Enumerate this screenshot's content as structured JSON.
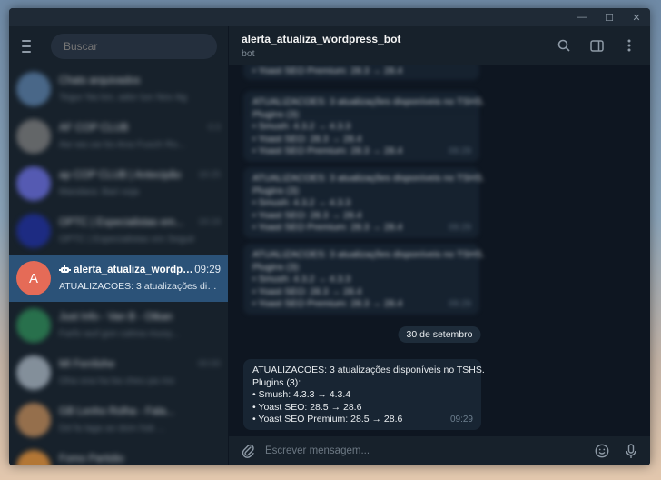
{
  "window": {
    "minimize_glyph": "—",
    "maximize_glyph": "☐",
    "close_glyph": "✕"
  },
  "sidebar": {
    "search_placeholder": "Buscar",
    "chats_above": [
      {
        "name": "Chats arquivados",
        "preview": "Tegur Na lon, ador tun Nov Ag",
        "time": "",
        "color": "#5a7fa8"
      },
      {
        "name": "AF COP CLUB",
        "preview": "Aw wa uw bo Ana Fusch Ro...",
        "time": "0:3",
        "color": "#7d7d7d"
      },
      {
        "name": "ap COP CLUB | Antecipão",
        "preview": "Mandara: Bari soja",
        "time": "18:25",
        "color": "#6a6ee0"
      },
      {
        "name": "OPTC | Especialistas em...",
        "preview": "OPTC | Especialistas em Seguir",
        "time": "19:19",
        "color": "#1f2fa0"
      }
    ],
    "active_chat": {
      "avatar_letter": "A",
      "name": "alerta_atualiza_wordpress_bot",
      "time": "09:29",
      "preview": "ATUALIZACOES: 3 atualizações disponíveis no TSHS.",
      "avatar_color": "#e56b57"
    },
    "chats_below": [
      {
        "name": "Just Info - Van B - Otkan",
        "preview": "Farfo wuf gon cahna muoy...",
        "time": "",
        "color": "#2e8b57"
      },
      {
        "name": "MI Ferrilohe",
        "preview": "Oha ona ha ba cheu pa mo",
        "time": "00:00",
        "color": "#a8b4c0"
      },
      {
        "name": "GB Lenho Rolha - Fala...",
        "preview": "Dd fa laga ao dom hsk ...",
        "time": "",
        "color": "#c08a58"
      },
      {
        "name": "Fomo Partidio",
        "preview": "Tran e soly ah pada so ...",
        "time": "",
        "color": "#e8943a"
      }
    ]
  },
  "header": {
    "title": "alerta_atualiza_wordpress_bot",
    "subtitle": "bot"
  },
  "messages": {
    "blurred_top_tail": "• Yoast SEO Premium: 28.3 → 28.4",
    "blurred": [
      {
        "lines": [
          "ATUALIZACOES: 3 atualizações disponíveis no TSHS.",
          "Plugins (3):",
          "• Smush: 4.3.2 → 4.3.3",
          "• Yoast SEO: 28.3 → 28.4",
          "• Yoast SEO Premium: 28.3 → 28.4"
        ],
        "time": "09:29"
      },
      {
        "lines": [
          "ATUALIZACOES: 3 atualizações disponíveis no TSHS.",
          "Plugins (3):",
          "• Smush: 4.3.2 → 4.3.3",
          "• Yoast SEO: 28.3 → 28.4",
          "• Yoast SEO Premium: 28.3 → 28.4"
        ],
        "time": "09:29"
      },
      {
        "lines": [
          "ATUALIZACOES: 3 atualizações disponíveis no TSHS.",
          "Plugins (3):",
          "• Smush: 4.3.2 → 4.3.3",
          "• Yoast SEO: 28.3 → 28.4",
          "• Yoast SEO Premium: 28.3 → 28.4"
        ],
        "time": "09:29"
      }
    ],
    "date_separator": "30 de setembro",
    "latest": {
      "lines": [
        "ATUALIZACOES: 3 atualizações disponíveis no TSHS.",
        "Plugins (3):",
        "• Smush: 4.3.3 → 4.3.4",
        "• Yoast SEO: 28.5 → 28.6",
        "• Yoast SEO Premium: 28.5 → 28.6"
      ],
      "time": "09:29"
    }
  },
  "composer": {
    "placeholder": "Escrever mensagem..."
  }
}
